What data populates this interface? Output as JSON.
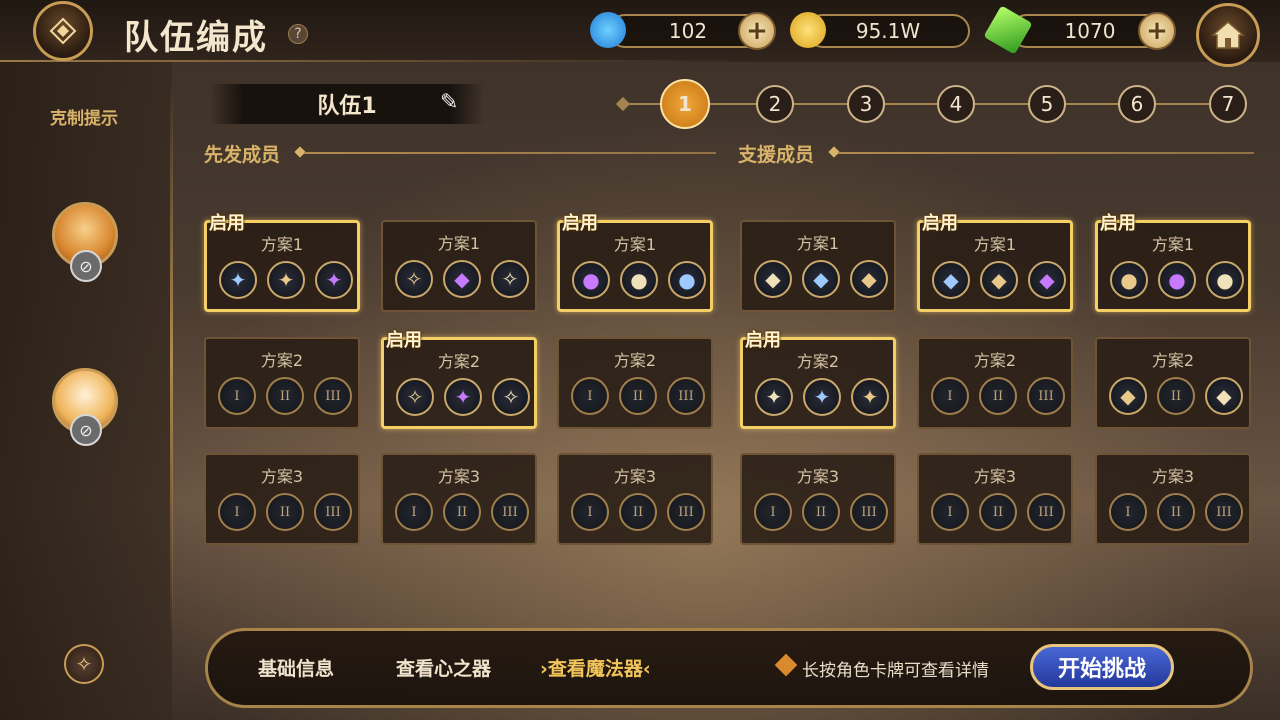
{
  "header": {
    "title": "队伍编成",
    "help": "?",
    "resources": [
      {
        "icon": "fish-icon",
        "value": "102",
        "has_plus": true
      },
      {
        "icon": "gold-coin-icon",
        "value": "95.1W",
        "has_plus": false
      },
      {
        "icon": "green-crystal-icon",
        "value": "1070",
        "has_plus": true
      }
    ],
    "plus": "+"
  },
  "sidebar": {
    "counter_hint": "克制提示"
  },
  "team": {
    "name": "队伍1",
    "numbers": [
      "1",
      "2",
      "3",
      "4",
      "5",
      "6",
      "7"
    ],
    "active_index": 0
  },
  "sections": {
    "starters": "先发成员",
    "support": "支援成员"
  },
  "enabled_label": "启用",
  "columns": [
    {
      "plans": [
        {
          "title": "方案1",
          "enabled": true,
          "slots": [
            "✦",
            "✦",
            "✦"
          ]
        },
        {
          "title": "方案2",
          "enabled": false,
          "slots": [
            "I",
            "II",
            "III"
          ]
        },
        {
          "title": "方案3",
          "enabled": false,
          "slots": [
            "I",
            "II",
            "III"
          ]
        }
      ]
    },
    {
      "plans": [
        {
          "title": "方案1",
          "enabled": false,
          "slots": [
            "✧",
            "◆",
            "✧"
          ]
        },
        {
          "title": "方案2",
          "enabled": true,
          "slots": [
            "✧",
            "✦",
            "✧"
          ]
        },
        {
          "title": "方案3",
          "enabled": false,
          "slots": [
            "I",
            "II",
            "III"
          ]
        }
      ]
    },
    {
      "plans": [
        {
          "title": "方案1",
          "enabled": true,
          "slots": [
            "●",
            "●",
            "●"
          ]
        },
        {
          "title": "方案2",
          "enabled": false,
          "slots": [
            "I",
            "II",
            "III"
          ]
        },
        {
          "title": "方案3",
          "enabled": false,
          "slots": [
            "I",
            "II",
            "III"
          ]
        }
      ]
    },
    {
      "plans": [
        {
          "title": "方案1",
          "enabled": false,
          "slots": [
            "◆",
            "◆",
            "◆"
          ]
        },
        {
          "title": "方案2",
          "enabled": true,
          "slots": [
            "✦",
            "✦",
            "✦"
          ]
        },
        {
          "title": "方案3",
          "enabled": false,
          "slots": [
            "I",
            "II",
            "III"
          ]
        }
      ]
    },
    {
      "plans": [
        {
          "title": "方案1",
          "enabled": true,
          "slots": [
            "◆",
            "◆",
            "◆"
          ]
        },
        {
          "title": "方案2",
          "enabled": false,
          "slots": [
            "I",
            "II",
            "III"
          ]
        },
        {
          "title": "方案3",
          "enabled": false,
          "slots": [
            "I",
            "II",
            "III"
          ]
        }
      ]
    },
    {
      "plans": [
        {
          "title": "方案1",
          "enabled": true,
          "slots": [
            "●",
            "●",
            "●"
          ]
        },
        {
          "title": "方案2",
          "enabled": false,
          "slots": [
            "◆",
            "II",
            "◆"
          ]
        },
        {
          "title": "方案3",
          "enabled": false,
          "slots": [
            "I",
            "II",
            "III"
          ]
        }
      ]
    }
  ],
  "bottom": {
    "tabs": [
      "基础信息",
      "查看心之器",
      "查看魔法器"
    ],
    "active_tab": 2,
    "active_tab_display": "›查看魔法器‹",
    "hint": "长按角色卡牌可查看详情",
    "start": "开始挑战"
  },
  "colors": {
    "accent_gold": "#f4cf66",
    "active_team": "#e28a1c",
    "start_button": "#3550c0"
  }
}
